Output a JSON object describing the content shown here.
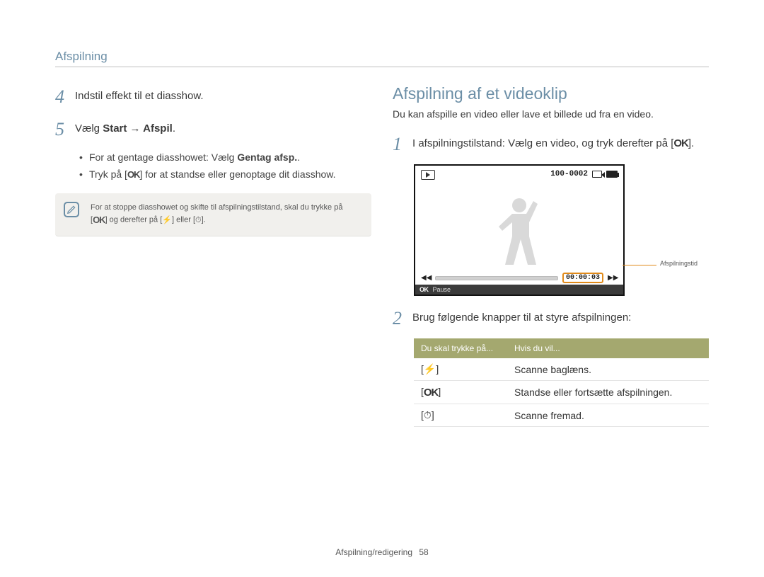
{
  "breadcrumb": "Afspilning",
  "left": {
    "step4_num": "4",
    "step4_text": "Indstil effekt til et diasshow.",
    "step5_num": "5",
    "step5_text_pre": "Vælg ",
    "step5_text_bold": "Start → Afspil",
    "step5_text_post": ".",
    "bullet1_pre": "For at gentage diasshowet: Vælg ",
    "bullet1_bold": "Gentag afsp.",
    "bullet1_post": ".",
    "bullet2_pre": "Tryk på [",
    "bullet2_icon": "OK",
    "bullet2_post": "] for at standse eller genoptage dit diasshow.",
    "note_l1_pre": "For at stoppe diasshowet og skifte til afspilningstilstand, skal du trykke på",
    "note_l2_pre": "[",
    "note_l2_a": "OK",
    "note_l2_mid": "] og derefter på [",
    "note_l2_b": "⚡",
    "note_l2_mid2": "] eller [",
    "note_l2_c": "⏱",
    "note_l2_post": "]."
  },
  "right": {
    "heading": "Afspilning af et videoklip",
    "lead": "Du kan afspille en video eller lave et billede ud fra en video.",
    "step1_num": "1",
    "step1_text_pre": "I afspilningstilstand: Vælg en video, og tryk derefter på [",
    "step1_icon": "OK",
    "step1_text_post": "].",
    "video": {
      "counter": "100-0002",
      "time": "00:00:03",
      "pause_label": "Pause",
      "ok_label": "OK",
      "caption": "Afspilningstid"
    },
    "step2_num": "2",
    "step2_text": "Brug følgende knapper til at styre afspilningen:",
    "table": {
      "h1": "Du skal trykke på...",
      "h2": "Hvis du vil...",
      "rows": [
        {
          "key_l": "[",
          "key_g": "⚡",
          "key_r": "]",
          "val": "Scanne baglæns."
        },
        {
          "key_l": "[",
          "key_g": "OK",
          "key_r": "]",
          "val": "Standse eller fortsætte afspilningen."
        },
        {
          "key_l": "[",
          "key_g": "⏱",
          "key_r": "]",
          "val": "Scanne fremad."
        }
      ]
    }
  },
  "footer": {
    "section": "Afspilning/redigering",
    "page": "58"
  }
}
